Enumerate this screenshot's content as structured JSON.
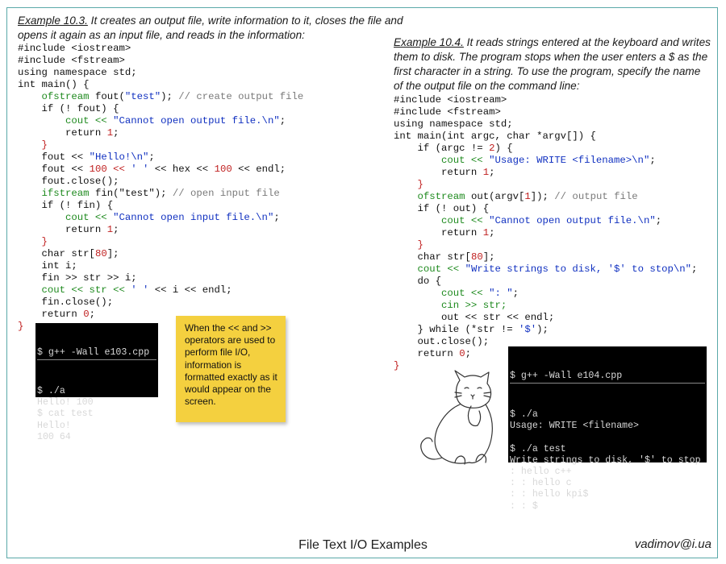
{
  "example1": {
    "label": "Example 10.3.",
    "text_line1": " It creates an output file, write information to it, closes the file and",
    "text_line2": "opens it again as an input file, and reads in the information:",
    "code": [
      [
        [
          "#include <iostream>",
          "kw"
        ]
      ],
      [
        [
          "#include <fstream>",
          "kw"
        ]
      ],
      [
        [
          "using namespace std;",
          "kw"
        ]
      ],
      [
        [
          "int main() {",
          "kw"
        ]
      ],
      [
        [
          "    ",
          "kw"
        ],
        [
          "ofstream",
          "ty"
        ],
        [
          " fout(",
          "kw"
        ],
        [
          "\"test\"",
          "str"
        ],
        [
          "); ",
          "kw"
        ],
        [
          "// create output file",
          "cm"
        ]
      ],
      [
        [
          "    if (! fout) {",
          "kw"
        ]
      ],
      [
        [
          "        cout << ",
          "ty"
        ],
        [
          "\"Cannot open output file.\\n\"",
          "str"
        ],
        [
          ";",
          "kw"
        ]
      ],
      [
        [
          "        return ",
          "kw"
        ],
        [
          "1",
          "num"
        ],
        [
          ";",
          "kw"
        ]
      ],
      [
        [
          "    }",
          "op"
        ]
      ],
      [
        [
          "    fout << ",
          "kw"
        ],
        [
          "\"Hello!\\n\"",
          "str"
        ],
        [
          ";",
          "kw"
        ]
      ],
      [
        [
          "    fout << ",
          "kw"
        ],
        [
          "100",
          "num"
        ],
        [
          " << ",
          "op"
        ],
        [
          "' '",
          "str"
        ],
        [
          " << hex << ",
          "kw"
        ],
        [
          "100",
          "num"
        ],
        [
          " << endl;",
          "kw"
        ]
      ],
      [
        [
          "    fout.close();",
          "kw"
        ]
      ],
      [
        [
          "    ",
          "kw"
        ],
        [
          "ifstream",
          "ty"
        ],
        [
          " fin(\"test\"); ",
          "kw"
        ],
        [
          "// open input file",
          "cm"
        ]
      ],
      [
        [
          "    if (! fin) {",
          "kw"
        ]
      ],
      [
        [
          "        cout << ",
          "ty"
        ],
        [
          "\"Cannot open input file.\\n\"",
          "str"
        ],
        [
          ";",
          "kw"
        ]
      ],
      [
        [
          "        return ",
          "kw"
        ],
        [
          "1",
          "num"
        ],
        [
          ";",
          "kw"
        ]
      ],
      [
        [
          "    }",
          "op"
        ]
      ],
      [
        [
          "    char str[",
          "kw"
        ],
        [
          "80",
          "num"
        ],
        [
          "];",
          "kw"
        ]
      ],
      [
        [
          "    int i;",
          "kw"
        ]
      ],
      [
        [
          "    fin >> str >> i;",
          "kw"
        ]
      ],
      [
        [
          "    cout << str << ",
          "ty"
        ],
        [
          "' '",
          "str"
        ],
        [
          " << i << endl;",
          "kw"
        ]
      ],
      [
        [
          "    fin.close();",
          "kw"
        ]
      ],
      [
        [
          "    return ",
          "kw"
        ],
        [
          "0",
          "num"
        ],
        [
          ";",
          "kw"
        ]
      ],
      [
        [
          "}",
          "op"
        ]
      ]
    ]
  },
  "terminal1": {
    "title": "$ g++ -Wall e103.cpp",
    "lines": [
      "$ ./a",
      "Hello! 100",
      "$ cat test",
      "Hello!",
      "100 64"
    ]
  },
  "note": {
    "text": "When the << and >> operators are used to perform file I/O, information is formatted exactly as it would appear on the screen."
  },
  "example2": {
    "label": "Example 10.4.",
    "text_line1": " It reads strings entered at the keyboard and writes",
    "text_line2": "them to disk. The program stops when the user enters a $ as the",
    "text_line3": "first character in a string. To use the program, specify the name",
    "text_line4": "of the output  file on the command line:",
    "code": [
      [
        [
          "#include <iostream>",
          "kw"
        ]
      ],
      [
        [
          "#include <fstream>",
          "kw"
        ]
      ],
      [
        [
          "using namespace std;",
          "kw"
        ]
      ],
      [
        [
          "int main(int argc, char *argv[]) {",
          "kw"
        ]
      ],
      [
        [
          "    if (argc != ",
          "kw"
        ],
        [
          "2",
          "num"
        ],
        [
          ") {",
          "kw"
        ]
      ],
      [
        [
          "        cout << ",
          "ty"
        ],
        [
          "\"Usage: WRITE <filename>\\n\"",
          "str"
        ],
        [
          ";",
          "kw"
        ]
      ],
      [
        [
          "        return ",
          "kw"
        ],
        [
          "1",
          "num"
        ],
        [
          ";",
          "kw"
        ]
      ],
      [
        [
          "    }",
          "op"
        ]
      ],
      [
        [
          "    ",
          "kw"
        ],
        [
          "ofstream",
          "ty"
        ],
        [
          " out(argv[",
          "kw"
        ],
        [
          "1",
          "num"
        ],
        [
          "]); ",
          "kw"
        ],
        [
          "// output file",
          "cm"
        ]
      ],
      [
        [
          "    if (! out) {",
          "kw"
        ]
      ],
      [
        [
          "        cout << ",
          "ty"
        ],
        [
          "\"Cannot open output file.\\n\"",
          "str"
        ],
        [
          ";",
          "kw"
        ]
      ],
      [
        [
          "        return ",
          "kw"
        ],
        [
          "1",
          "num"
        ],
        [
          ";",
          "kw"
        ]
      ],
      [
        [
          "    }",
          "op"
        ]
      ],
      [
        [
          "    char str[",
          "kw"
        ],
        [
          "80",
          "num"
        ],
        [
          "];",
          "kw"
        ]
      ],
      [
        [
          "    cout << ",
          "ty"
        ],
        [
          "\"Write strings to disk, '$' to stop\\n\"",
          "str"
        ],
        [
          ";",
          "kw"
        ]
      ],
      [
        [
          "    do {",
          "kw"
        ]
      ],
      [
        [
          "        cout << ",
          "ty"
        ],
        [
          "\": \"",
          "str"
        ],
        [
          ";",
          "kw"
        ]
      ],
      [
        [
          "        cin >> str;",
          "ty"
        ]
      ],
      [
        [
          "        out << str << endl;",
          "kw"
        ]
      ],
      [
        [
          "    } while (*str != ",
          "kw"
        ],
        [
          "'$'",
          "str"
        ],
        [
          ");",
          "kw"
        ]
      ],
      [
        [
          "    out.close();",
          "kw"
        ]
      ],
      [
        [
          "    return ",
          "kw"
        ],
        [
          "0",
          "num"
        ],
        [
          ";",
          "kw"
        ]
      ],
      [
        [
          "}",
          "op"
        ]
      ]
    ]
  },
  "terminal2": {
    "title": "$ g++ -Wall e104.cpp",
    "lines": [
      "$ ./a",
      "Usage: WRITE <filename>",
      "",
      "$ ./a test",
      "Write strings to disk, '$' to stop",
      ": hello c++",
      ": : hello c",
      ": : hello kpi$",
      ": : $"
    ]
  },
  "footer": {
    "title": "File Text I/O Examples",
    "email": "vadimov@i.ua"
  },
  "colors": {
    "frame": "#5aa9a9",
    "type": "#1e8a1e",
    "string": "#1030c0",
    "comment": "#7a7a7a",
    "number": "#c02020",
    "note": "#f4d03f"
  },
  "icons": {
    "illustration": "cat-drawing-icon"
  }
}
